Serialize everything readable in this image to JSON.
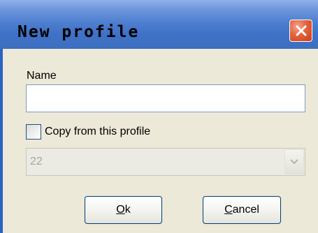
{
  "dialog": {
    "title": "New profile",
    "close_icon": "close-icon"
  },
  "form": {
    "name_label": "Name",
    "name_value": "",
    "copy_checkbox_label": "Copy from this profile",
    "copy_checked": false,
    "profile_select_value": "22",
    "select_arrow_icon": "chevron-down-icon"
  },
  "buttons": {
    "ok_mnemonic": "O",
    "ok_rest": "k",
    "cancel_mnemonic": "C",
    "cancel_rest": "ancel"
  },
  "colors": {
    "titlebar": "#3f71c6",
    "close_button": "#e4623b",
    "dialog_background": "#ece9d8",
    "button_border": "#003c74"
  }
}
